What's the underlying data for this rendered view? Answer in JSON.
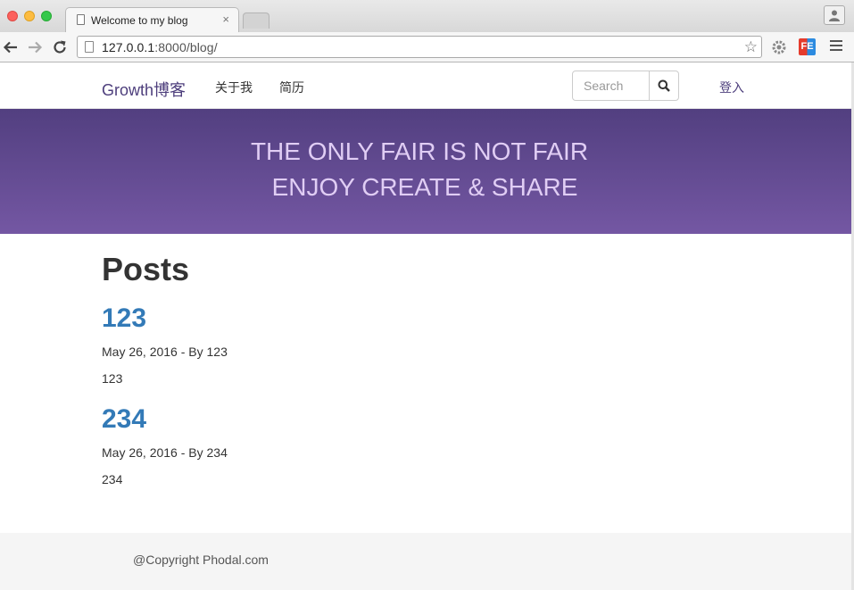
{
  "browser": {
    "tab": {
      "title": "Welcome to my blog",
      "close_glyph": "×"
    },
    "url": {
      "host": "127.0.0.1",
      "rest": ":8000/blog/"
    },
    "star_glyph": "☆",
    "extension_label": "FE",
    "icons": [
      "back-arrow-icon",
      "forward-arrow-icon",
      "reload-icon",
      "page-icon",
      "bookmark-star-icon",
      "extension-gear-icon",
      "fe-extension-icon",
      "menu-icon",
      "profile-icon"
    ],
    "traffic_light_colors": {
      "close": "#fc605c",
      "minimize": "#fdbc40",
      "zoom": "#34c84a"
    }
  },
  "navbar": {
    "brand": "Growth博客",
    "links": [
      {
        "label": "关于我"
      },
      {
        "label": "简历"
      }
    ],
    "search": {
      "placeholder": "Search"
    },
    "login": "登入"
  },
  "hero": {
    "line1": "THE ONLY FAIR IS NOT FAIR",
    "line2": "ENJOY CREATE & SHARE",
    "gradient": [
      "#523f80",
      "#7457a3"
    ],
    "text_color": "#e0cdf4"
  },
  "main": {
    "heading": "Posts",
    "posts": [
      {
        "title": "123",
        "meta": "May 26, 2016 - By 123",
        "body": "123"
      },
      {
        "title": "234",
        "meta": "May 26, 2016 - By 234",
        "body": "234"
      }
    ],
    "link_color": "#337ab7"
  },
  "footer": {
    "text": "@Copyright Phodal.com"
  }
}
